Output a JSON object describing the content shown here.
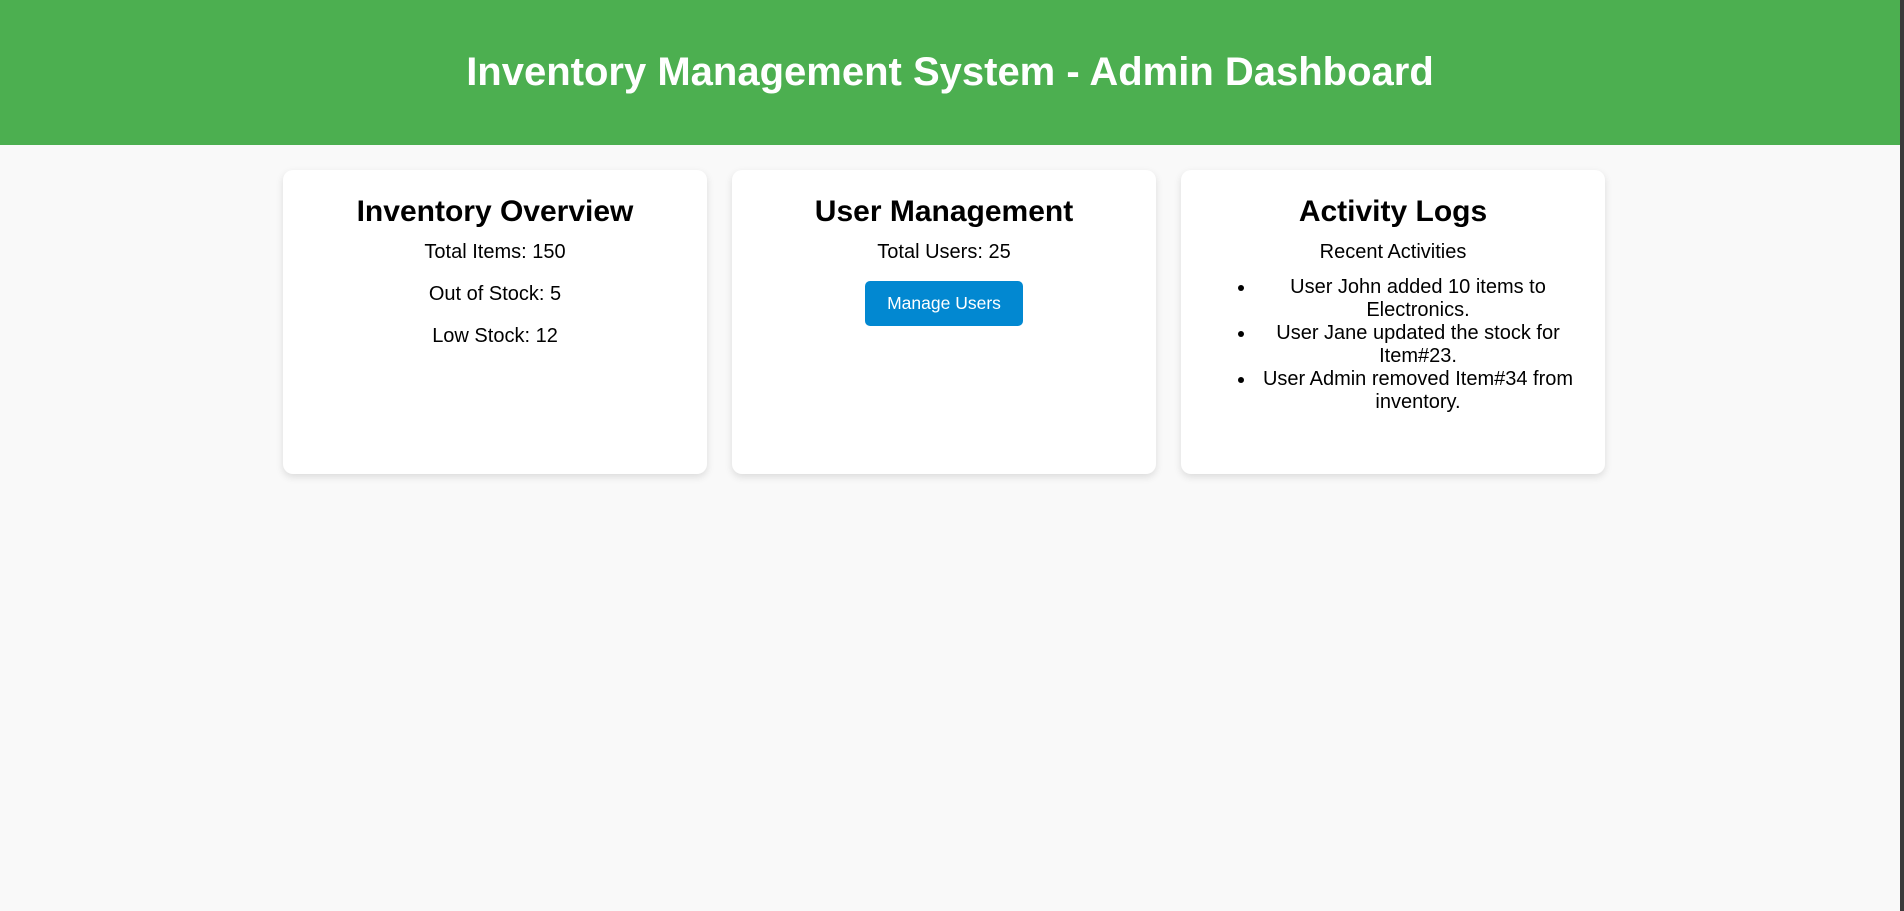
{
  "header": {
    "title": "Inventory Management System - Admin Dashboard"
  },
  "inventory": {
    "title": "Inventory Overview",
    "total_items": "Total Items: 150",
    "out_of_stock": "Out of Stock: 5",
    "low_stock": "Low Stock: 12"
  },
  "users": {
    "title": "User Management",
    "total_users": "Total Users: 25",
    "manage_button": "Manage Users"
  },
  "activity": {
    "title": "Activity Logs",
    "subtitle": "Recent Activities",
    "items": [
      "User John added 10 items to Electronics.",
      "User Jane updated the stock for Item#23.",
      "User Admin removed Item#34 from inventory."
    ]
  },
  "colors": {
    "header": "#4caf50",
    "button": "#0288d1"
  }
}
